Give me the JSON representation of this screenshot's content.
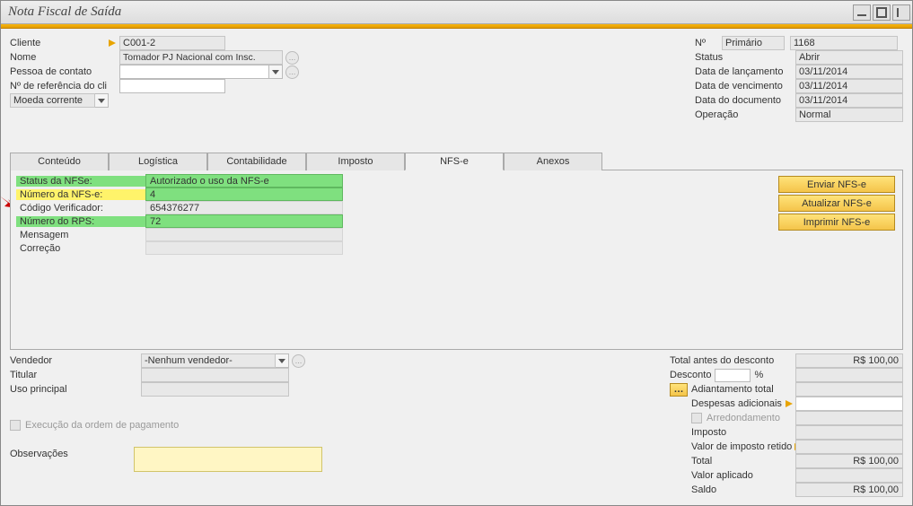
{
  "window": {
    "title": "Nota Fiscal de Saída"
  },
  "header_left": {
    "cliente_label": "Cliente",
    "cliente_value": "C001-2",
    "nome_label": "Nome",
    "nome_value": "Tomador PJ Nacional com Insc.",
    "pessoa_label": "Pessoa de contato",
    "pessoa_value": "",
    "ref_label": "Nº de referência do clie",
    "ref_value": "",
    "moeda_label": "Moeda corrente",
    "moeda_value": ""
  },
  "header_right": {
    "no_label": "Nº",
    "no_type": "Primário",
    "no_value": "1168",
    "status_label": "Status",
    "status_value": "Abrir",
    "lanc_label": "Data de lançamento",
    "lanc_value": "03/11/2014",
    "venc_label": "Data de vencimento",
    "venc_value": "03/11/2014",
    "doc_label": "Data do documento",
    "doc_value": "03/11/2014",
    "oper_label": "Operação",
    "oper_value": "Normal"
  },
  "tabs": {
    "conteudo": "Conteúdo",
    "logistica": "Logística",
    "contabilidade": "Contabilidade",
    "imposto": "Imposto",
    "nfse": "NFS-e",
    "anexos": "Anexos"
  },
  "nfse": {
    "status_label": "Status da NFSe:",
    "status_value": "Autorizado o uso da NFS-e",
    "numero_label": "Número da NFS-e:",
    "numero_value": "4",
    "codigo_label": "Código Verificador:",
    "codigo_value": "654376277",
    "rps_label": "Número do RPS:",
    "rps_value": "72",
    "mensagem_label": "Mensagem",
    "mensagem_value": "",
    "correcao_label": "Correção",
    "correcao_value": ""
  },
  "nfse_buttons": {
    "enviar": "Enviar NFS-e",
    "atualizar": "Atualizar NFS-e",
    "imprimir": "Imprimir NFS-e"
  },
  "footer_left": {
    "vendedor_label": "Vendedor",
    "vendedor_value": "-Nenhum vendedor-",
    "titular_label": "Titular",
    "titular_value": "",
    "uso_label": "Uso principal",
    "uso_value": "",
    "exec_label": "Execução da ordem de pagamento",
    "obs_label": "Observações"
  },
  "totals": {
    "antes_label": "Total antes do desconto",
    "antes_value": "R$ 100,00",
    "desconto_label": "Desconto",
    "desconto_pct": "",
    "desconto_unit": "%",
    "desconto_value": "",
    "adiant_label": "Adiantamento total",
    "adiant_value": "",
    "desp_label": "Despesas adicionais",
    "desp_value": "",
    "arred_label": "Arredondamento",
    "arred_value": "",
    "imposto_label": "Imposto",
    "imposto_value": "",
    "retido_label": "Valor de imposto retido",
    "retido_value": "",
    "total_label": "Total",
    "total_value": "R$ 100,00",
    "aplicado_label": "Valor aplicado",
    "aplicado_value": "",
    "saldo_label": "Saldo",
    "saldo_value": "R$ 100,00"
  }
}
